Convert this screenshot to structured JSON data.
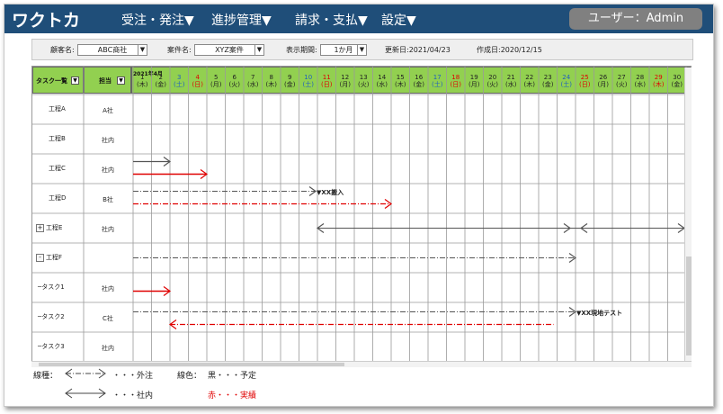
{
  "app": {
    "logo": "ワクトカ"
  },
  "menu": [
    {
      "label": "受注・発注▼"
    },
    {
      "label": "進捗管理▼"
    },
    {
      "label": "請求・支払▼"
    },
    {
      "label": "設定▼"
    }
  ],
  "user": {
    "label": "ユーザー：Admin"
  },
  "filters": {
    "client_label": "顧客名:",
    "client_value": "ABC商社",
    "case_label": "案件名:",
    "case_value": "XYZ案件",
    "period_label": "表示期間:",
    "period_value": "1か月",
    "updated": "更新日:2021/04/23",
    "created": "作成日:2020/12/15",
    "dropdown_arrow": "▼"
  },
  "gantt": {
    "task_header": "タスク一覧",
    "owner_header": "担当",
    "header_arrow": "▼",
    "month": "2021年4月",
    "days": [
      {
        "d": "1",
        "w": "(木)",
        "c": "#222222"
      },
      {
        "d": "2",
        "w": "(金)",
        "c": "#222222"
      },
      {
        "d": "3",
        "w": "(土)",
        "c": "#1f5fbf"
      },
      {
        "d": "4",
        "w": "(日)",
        "c": "#e00000"
      },
      {
        "d": "5",
        "w": "(月)",
        "c": "#222222"
      },
      {
        "d": "6",
        "w": "(火)",
        "c": "#222222"
      },
      {
        "d": "7",
        "w": "(水)",
        "c": "#222222"
      },
      {
        "d": "8",
        "w": "(木)",
        "c": "#222222"
      },
      {
        "d": "9",
        "w": "(金)",
        "c": "#222222"
      },
      {
        "d": "10",
        "w": "(土)",
        "c": "#1f5fbf"
      },
      {
        "d": "11",
        "w": "(日)",
        "c": "#e00000"
      },
      {
        "d": "12",
        "w": "(月)",
        "c": "#222222"
      },
      {
        "d": "13",
        "w": "(火)",
        "c": "#222222"
      },
      {
        "d": "14",
        "w": "(水)",
        "c": "#222222"
      },
      {
        "d": "15",
        "w": "(木)",
        "c": "#222222"
      },
      {
        "d": "16",
        "w": "(金)",
        "c": "#222222"
      },
      {
        "d": "17",
        "w": "(土)",
        "c": "#1f5fbf"
      },
      {
        "d": "18",
        "w": "(日)",
        "c": "#e00000"
      },
      {
        "d": "19",
        "w": "(月)",
        "c": "#222222"
      },
      {
        "d": "20",
        "w": "(火)",
        "c": "#222222"
      },
      {
        "d": "21",
        "w": "(水)",
        "c": "#222222"
      },
      {
        "d": "22",
        "w": "(木)",
        "c": "#222222"
      },
      {
        "d": "23",
        "w": "(金)",
        "c": "#222222"
      },
      {
        "d": "24",
        "w": "(土)",
        "c": "#1f5fbf"
      },
      {
        "d": "25",
        "w": "(日)",
        "c": "#e00000"
      },
      {
        "d": "26",
        "w": "(月)",
        "c": "#222222"
      },
      {
        "d": "27",
        "w": "(火)",
        "c": "#222222"
      },
      {
        "d": "28",
        "w": "(水)",
        "c": "#222222"
      },
      {
        "d": "29",
        "w": "(木)",
        "c": "#e00000"
      },
      {
        "d": "30",
        "w": "(金)",
        "c": "#222222"
      }
    ],
    "rows": [
      {
        "task": "工程A",
        "owner": "A社",
        "toggle": ""
      },
      {
        "task": "工程B",
        "owner": "社内",
        "toggle": ""
      },
      {
        "task": "工程C",
        "owner": "社内",
        "toggle": ""
      },
      {
        "task": "工程D",
        "owner": "B社",
        "toggle": ""
      },
      {
        "task": "工程E",
        "owner": "社内",
        "toggle": "+"
      },
      {
        "task": "工程F",
        "owner": "",
        "toggle": "-"
      },
      {
        "task": "─タスク1",
        "owner": "社内",
        "toggle": ""
      },
      {
        "task": "─タスク2",
        "owner": "C社",
        "toggle": ""
      },
      {
        "task": "─タスク3",
        "owner": "社内",
        "toggle": ""
      }
    ],
    "annotations": {
      "d_note": "▼XX搬入",
      "t2_note": "▼XX現地テスト"
    }
  },
  "legend": {
    "line_type_label": "線種：",
    "outsource_text": "・・・外注",
    "inhouse_text": "・・・社内",
    "line_color_label": "線色：",
    "black_text": "黒・・・予定",
    "red_text": "赤・・・実績",
    "red_color": "#e00000"
  },
  "colors": {
    "topbar": "#1f4e79",
    "header_green": "#92d050",
    "plan_black": "#555555",
    "actual_red": "#e00000"
  }
}
